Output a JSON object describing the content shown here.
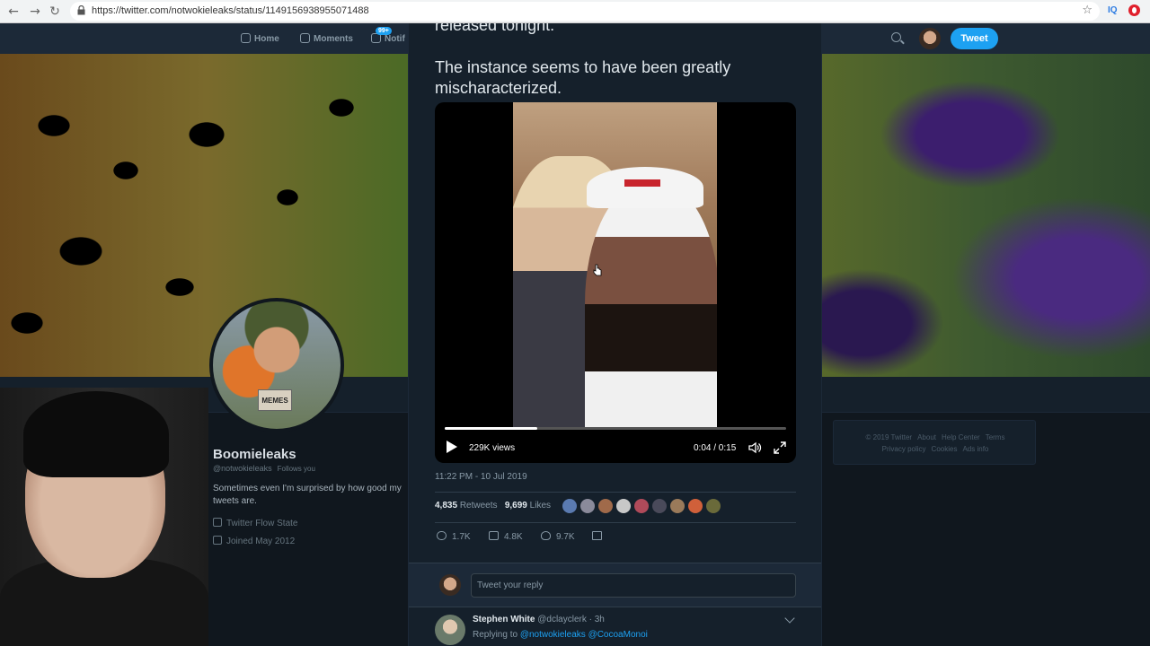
{
  "browser": {
    "url": "https://twitter.com/notwokieleaks/status/1149156938955071488",
    "ext_label": "IQ"
  },
  "topnav": {
    "home": "Home",
    "moments": "Moments",
    "notifications": "Notif",
    "badge": "99+",
    "tweet_button": "Tweet"
  },
  "profile": {
    "name": "Boomieleaks",
    "handle": "@notwokieleaks",
    "follows_you": "Follows you",
    "bio": "Sometimes even I'm surprised by how good my tweets are.",
    "location": "Twitter Flow State",
    "joined": "Joined May 2012",
    "mug_text": "MEMES"
  },
  "tweet": {
    "text_line1": "released tonight.",
    "text_main": "The instance seems to have been greatly mischaracterized.",
    "video": {
      "views": "229K views",
      "time": "0:04 / 0:15",
      "progress": 0.27
    },
    "timestamp": "11:22 PM - 10 Jul 2019",
    "retweets_count": "4,835",
    "retweets_label": "Retweets",
    "likes_count": "9,699",
    "likes_label": "Likes",
    "actions": {
      "replies": "1.7K",
      "retweets": "4.8K",
      "likes": "9.7K"
    },
    "liker_colors": [
      "#5a7ab0",
      "#8a8a9a",
      "#a06a4a",
      "#c8c8c8",
      "#b04a5a",
      "#4a4a5a",
      "#9a7a5a",
      "#d0603a",
      "#6a6a3a"
    ]
  },
  "reply_box": {
    "placeholder": "Tweet your reply"
  },
  "reply": {
    "name": "Stephen White",
    "handle": "@dclayclerk",
    "age": "· 3h",
    "replying_to": "Replying to",
    "mention1": "@notwokieleaks",
    "mention2": "@CocoaMonoi"
  },
  "footer": {
    "links_row1": [
      "© 2019 Twitter",
      "About",
      "Help Center",
      "Terms"
    ],
    "links_row2": [
      "Privacy policy",
      "Cookies",
      "Ads info"
    ]
  },
  "colors": {
    "accent": "#1da1f2",
    "background": "#10171e",
    "panel": "#15202b"
  }
}
